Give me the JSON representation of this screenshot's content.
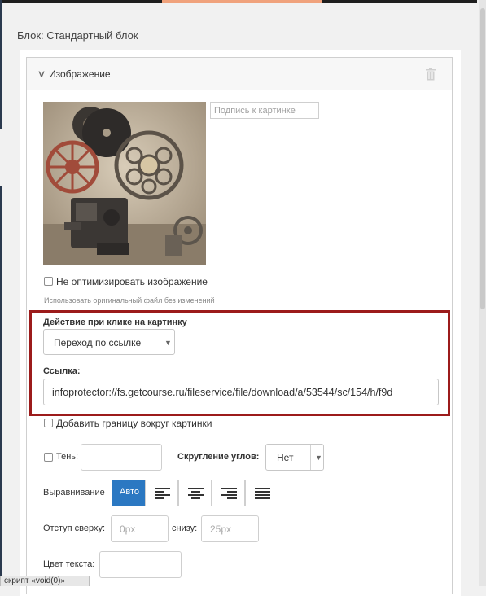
{
  "block": {
    "title": "Блок: Стандартный блок"
  },
  "panel": {
    "title": "Изображение"
  },
  "caption": {
    "placeholder": "Подпись к картинке"
  },
  "optimize": {
    "label": "Не оптимизировать изображение",
    "hint": "Использовать оригинальный файл без изменений",
    "checked": false
  },
  "click_action": {
    "label": "Действие при клике на картинку",
    "selected": "Переход по ссылке"
  },
  "link": {
    "label": "Ссылка:",
    "value": "infoprotector://fs.getcourse.ru/fileservice/file/download/a/53544/sc/154/h/f9d"
  },
  "border": {
    "label": "Добавить границу вокруг картинки",
    "checked": false
  },
  "shadow": {
    "label": "Тень:",
    "checked": false,
    "value": ""
  },
  "rounding": {
    "label": "Скругление углов:",
    "selected": "Нет"
  },
  "alignment": {
    "label": "Выравнивание",
    "auto_label": "Авто",
    "active": "auto",
    "options": [
      "auto",
      "left",
      "center",
      "right",
      "justify"
    ]
  },
  "padding": {
    "top_label": "Отступ сверху:",
    "top_placeholder": "0px",
    "bottom_label": "снизу:",
    "bottom_placeholder": "25px"
  },
  "text_color": {
    "label": "Цвет текста:",
    "value": ""
  },
  "status": {
    "text": "скрипт «void(0)»"
  },
  "colors": {
    "highlight": "#9c1b1b",
    "accent": "#2b78c2",
    "topbar_accent": "#f0a27c"
  }
}
